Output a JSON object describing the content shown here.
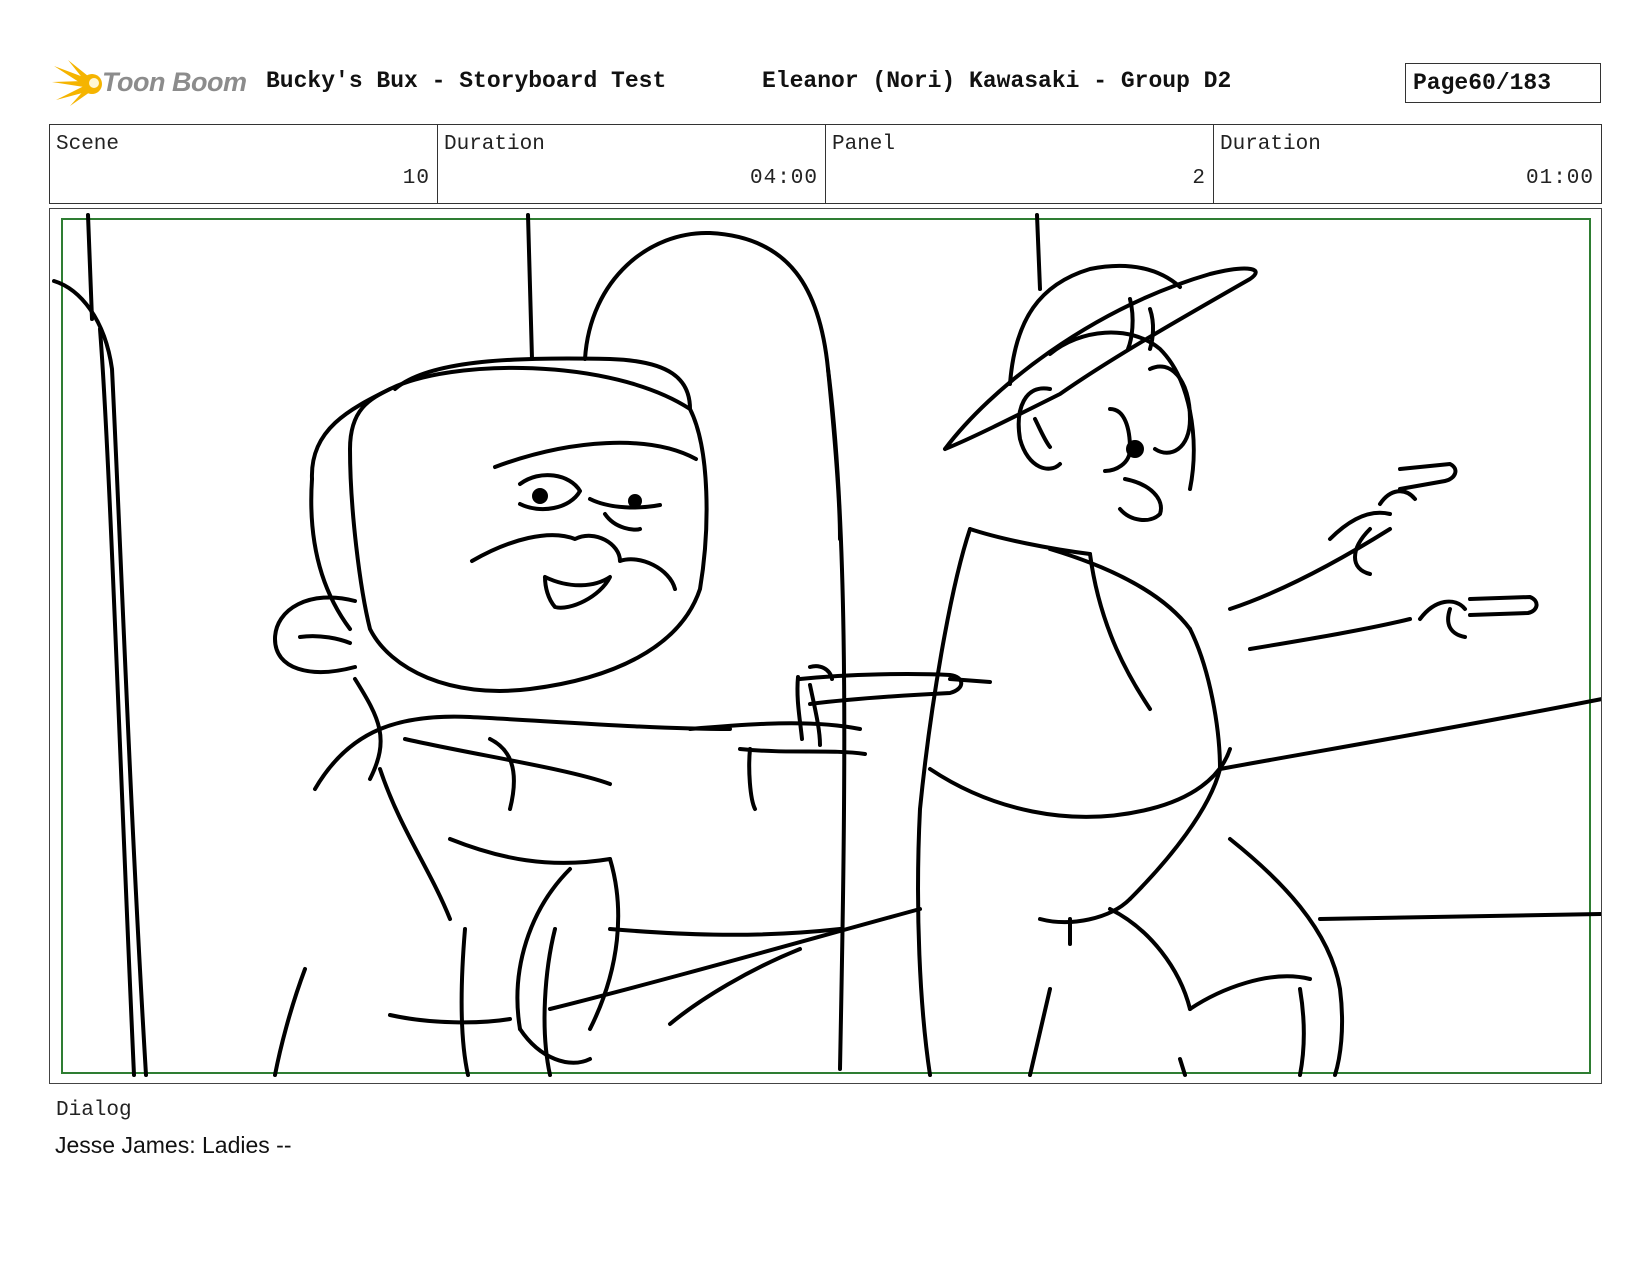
{
  "header": {
    "logo_text": "Toon Boom",
    "project_title": "Bucky's Bux - Storyboard Test",
    "author": "Eleanor (Nori) Kawasaki - Group D2",
    "page_label": "Page",
    "page_value": "60/183"
  },
  "info": {
    "scene_label": "Scene",
    "scene_value": "10",
    "scene_duration_label": "Duration",
    "scene_duration_value": "04:00",
    "panel_label": "Panel",
    "panel_value": "2",
    "panel_duration_label": "Duration",
    "panel_duration_value": "01:00"
  },
  "panel": {
    "image_subject": "storyboard sketch"
  },
  "dialog": {
    "label": "Dialog",
    "text": "Jesse James: Ladies --"
  },
  "colors": {
    "safe_area_border": "#2e7d32",
    "logo_accent": "#f5b400",
    "logo_text": "#8c8c8c"
  }
}
